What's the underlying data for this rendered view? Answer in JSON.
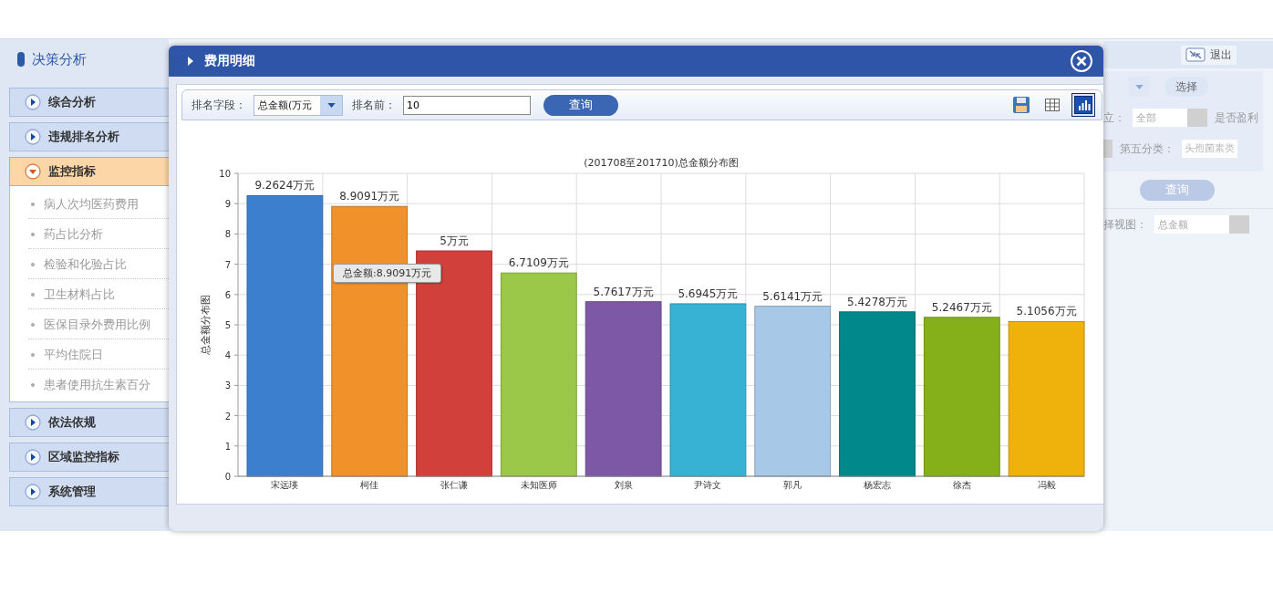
{
  "sidebar": {
    "title": "决策分析",
    "groups": [
      {
        "label": "综合分析",
        "expanded": false
      },
      {
        "label": "违规排名分析",
        "expanded": false
      },
      {
        "label": "监控指标",
        "expanded": true,
        "children": [
          "病人次均医药费用",
          "药占比分析",
          "检验和化验占比",
          "卫生材料占比",
          "医保目录外费用比例",
          "平均住院日",
          "患者使用抗生素百分"
        ]
      },
      {
        "label": "依法依规",
        "expanded": false
      },
      {
        "label": "区域监控指标",
        "expanded": false
      },
      {
        "label": "系统管理",
        "expanded": false
      }
    ]
  },
  "background_panel": {
    "exit_button": "退出",
    "select_button": "选择",
    "label_1": "立：",
    "select_1": "全部",
    "label_2": "是否盈利",
    "label_3": "第五分类：",
    "field_3": "头孢菌素类",
    "query_button": "查询",
    "label_4": "择视图：",
    "select_4": "总金额"
  },
  "dialog": {
    "title": "费用明细",
    "toolbar": {
      "field_label": "排名字段：",
      "field_value": "总金额(万元",
      "top_label": "排名前：",
      "top_value": "10",
      "query_button": "查询",
      "tools": [
        {
          "kind": "save",
          "selected": false
        },
        {
          "kind": "table",
          "selected": false
        },
        {
          "kind": "chart",
          "selected": true
        }
      ]
    },
    "tooltip": "总金额:8.9091万元",
    "chart_data": {
      "type": "bar",
      "title": "(201708至201710)总金额分布图",
      "ylabel": "总金额分布图",
      "categories": [
        "宋远瑛",
        "柯佳",
        "张仁谦",
        "未知医师",
        "刘泉",
        "尹诗文",
        "郭凡",
        "杨宏志",
        "徐杰",
        "冯毅"
      ],
      "series": [
        {
          "colors": [
            "#3d7fcf",
            "#f0912a",
            "#d2403c",
            "#9cc84a",
            "#7c58a6",
            "#37b1d4",
            "#a7c8e6",
            "#00888a",
            "#86b01a",
            "#efb10c"
          ],
          "values": [
            9.2624,
            8.9091,
            7.44,
            6.7109,
            5.7617,
            5.6945,
            5.6141,
            5.4278,
            5.2467,
            5.1056
          ]
        }
      ],
      "ylim": [
        0,
        10
      ],
      "grid": true,
      "yticks": [
        0,
        1,
        2,
        3,
        4,
        5,
        6,
        7,
        8,
        9,
        10
      ],
      "value_labels": [
        "9.2624万元",
        "8.9091万元",
        "5万元",
        "6.7109万元",
        "5.7617万元",
        "5.6945万元",
        "5.6141万元",
        "5.4278万元",
        "5.2467万元",
        "5.1056万元"
      ]
    }
  }
}
